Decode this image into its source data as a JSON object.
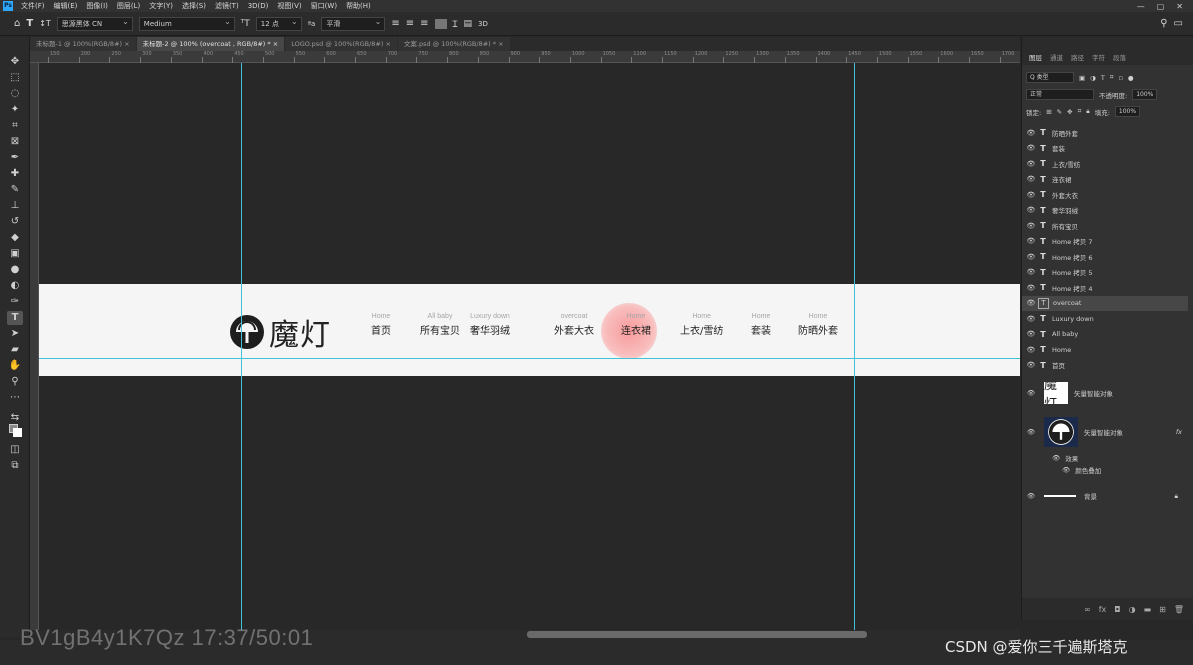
{
  "menubar": {
    "app_badge": "Ps",
    "items": [
      "文件(F)",
      "编辑(E)",
      "图像(I)",
      "图层(L)",
      "文字(Y)",
      "选择(S)",
      "滤镜(T)",
      "3D(D)",
      "视图(V)",
      "窗口(W)",
      "帮助(H)"
    ],
    "window_controls": [
      "—",
      "▢",
      "✕"
    ]
  },
  "options_bar": {
    "font_family": "思源黑体 CN",
    "font_style": "Medium",
    "font_size": "12 点",
    "aa_mode": "平滑",
    "aa_label": "ªa",
    "three_d_label": "3D"
  },
  "doc_tabs": [
    {
      "label": "未标题-1 @ 100%(RGB/8#)",
      "close": "×"
    },
    {
      "label": "未标题-2 @ 100% (overcoat , RGB/8#) *",
      "close": "×"
    },
    {
      "label": "LOGO.psd @ 100%(RGB/8#)",
      "close": "×"
    },
    {
      "label": "文案.psd @ 100%(RGB/8#) *",
      "close": "×"
    }
  ],
  "ruler_ticks": [
    "150",
    "200",
    "250",
    "300",
    "350",
    "400",
    "450",
    "500",
    "550",
    "600",
    "650",
    "700",
    "750",
    "800",
    "850",
    "900",
    "950",
    "1000",
    "1050",
    "1100",
    "1150",
    "1200",
    "1250",
    "1300",
    "1350",
    "1400",
    "1450",
    "1500",
    "1550",
    "1600",
    "1650",
    "1700"
  ],
  "banner": {
    "logo_text": "魔灯",
    "nav": [
      {
        "en": "Home",
        "zh": "首页"
      },
      {
        "en": "All baby",
        "zh": "所有宝贝"
      },
      {
        "en": "Luxury down",
        "zh": "奢华羽绒"
      },
      {
        "en": "overcoat",
        "zh": "外套大衣"
      },
      {
        "en": "Home",
        "zh": "连衣裙"
      },
      {
        "en": "Home",
        "zh": "上衣/雪纺"
      },
      {
        "en": "Home",
        "zh": "套装"
      },
      {
        "en": "Home",
        "zh": "防晒外套"
      }
    ]
  },
  "panel": {
    "tabs": [
      "图层",
      "通道",
      "路径",
      "字符",
      "段落"
    ],
    "filter_label": "Q 类型",
    "blend_mode": "正常",
    "opacity_label": "不透明度:",
    "opacity_value": "100%",
    "lock_label": "锁定:",
    "fill_label": "填充:",
    "fill_value": "100%",
    "layers": [
      "防晒外套",
      "套装",
      "上衣/雪纺",
      "连衣裙",
      "外套大衣",
      "奢华羽绒",
      "所有宝贝",
      "Home 拷贝 7",
      "Home 拷贝 6",
      "Home 拷贝 5",
      "Home 拷贝 4",
      "overcoat",
      "Luxury down",
      "All baby",
      "Home",
      "首页"
    ],
    "vector_layer_1": "矢量智能对象",
    "vector_layer_2": "矢量智能对象",
    "effects_label": "效果",
    "color_overlay_label": "颜色叠加",
    "fx_label": "fx",
    "background_layer": "背景"
  },
  "watermark": "BV1gB4y1K7Qz 17:37/50:01",
  "csdn_credit": "CSDN @爱你三千遍斯塔克",
  "colors": {
    "guide": "#3fc2d6",
    "highlight": "#f89696",
    "ps_blue": "#31a8ff"
  }
}
